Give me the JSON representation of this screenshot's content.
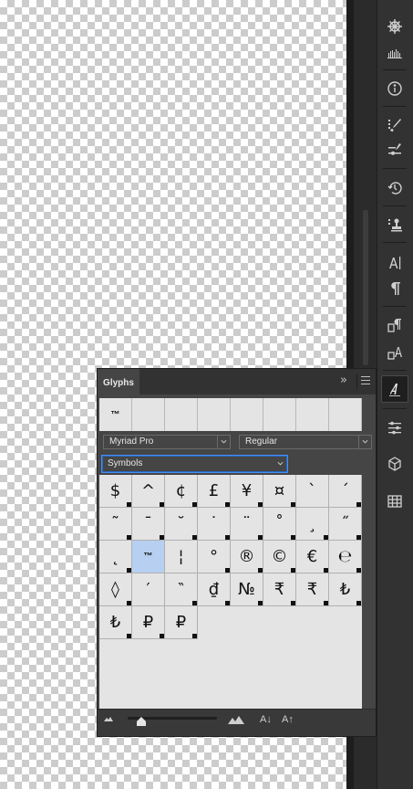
{
  "panel": {
    "title": "Glyphs",
    "collapse_glyph": "»",
    "menu_icon": "panel-menu-icon"
  },
  "recent_glyphs": [
    "™",
    "",
    "",
    "",
    "",
    "",
    "",
    ""
  ],
  "font_family": {
    "value": "Myriad Pro"
  },
  "font_style": {
    "value": "Regular"
  },
  "glyph_category": {
    "value": "Symbols"
  },
  "glyphs": [
    [
      "$",
      "^",
      "¢",
      "£",
      "¥",
      "¤",
      "`",
      "´"
    ],
    [
      "˜",
      "¯",
      "˘",
      "˙",
      "¨",
      "˚",
      "¸",
      "˝"
    ],
    [
      "˛",
      "™",
      "¦",
      "°",
      "®",
      "©",
      "€",
      "℮"
    ],
    [
      "◊",
      "′",
      "‶",
      "₫",
      "№",
      "₹",
      "₹",
      "₺"
    ],
    [
      "₺",
      "₽",
      "₽"
    ]
  ],
  "selected_glyph": "™",
  "glyph_size_level": 0.1,
  "footer": {
    "smaller_icon": "mountain-small-icon",
    "larger_icon": "mountain-large-icon",
    "font_down": "A↓",
    "font_up": "A↑"
  },
  "colors": {
    "selection": "#b7cff0",
    "focus": "#4a8ff0",
    "panel_bg": "#454545"
  },
  "dock_icons": [
    "compass-icon",
    "histogram-icon",
    "info-icon",
    "brush-presets-icon",
    "brush-settings-icon",
    "history-icon",
    "clone-source-icon",
    "character-icon",
    "paragraph-icon",
    "paragraph-styles-icon",
    "character-styles-icon",
    "glyphs-icon",
    "adjustments-icon",
    "3d-icon",
    "grid-icon"
  ]
}
